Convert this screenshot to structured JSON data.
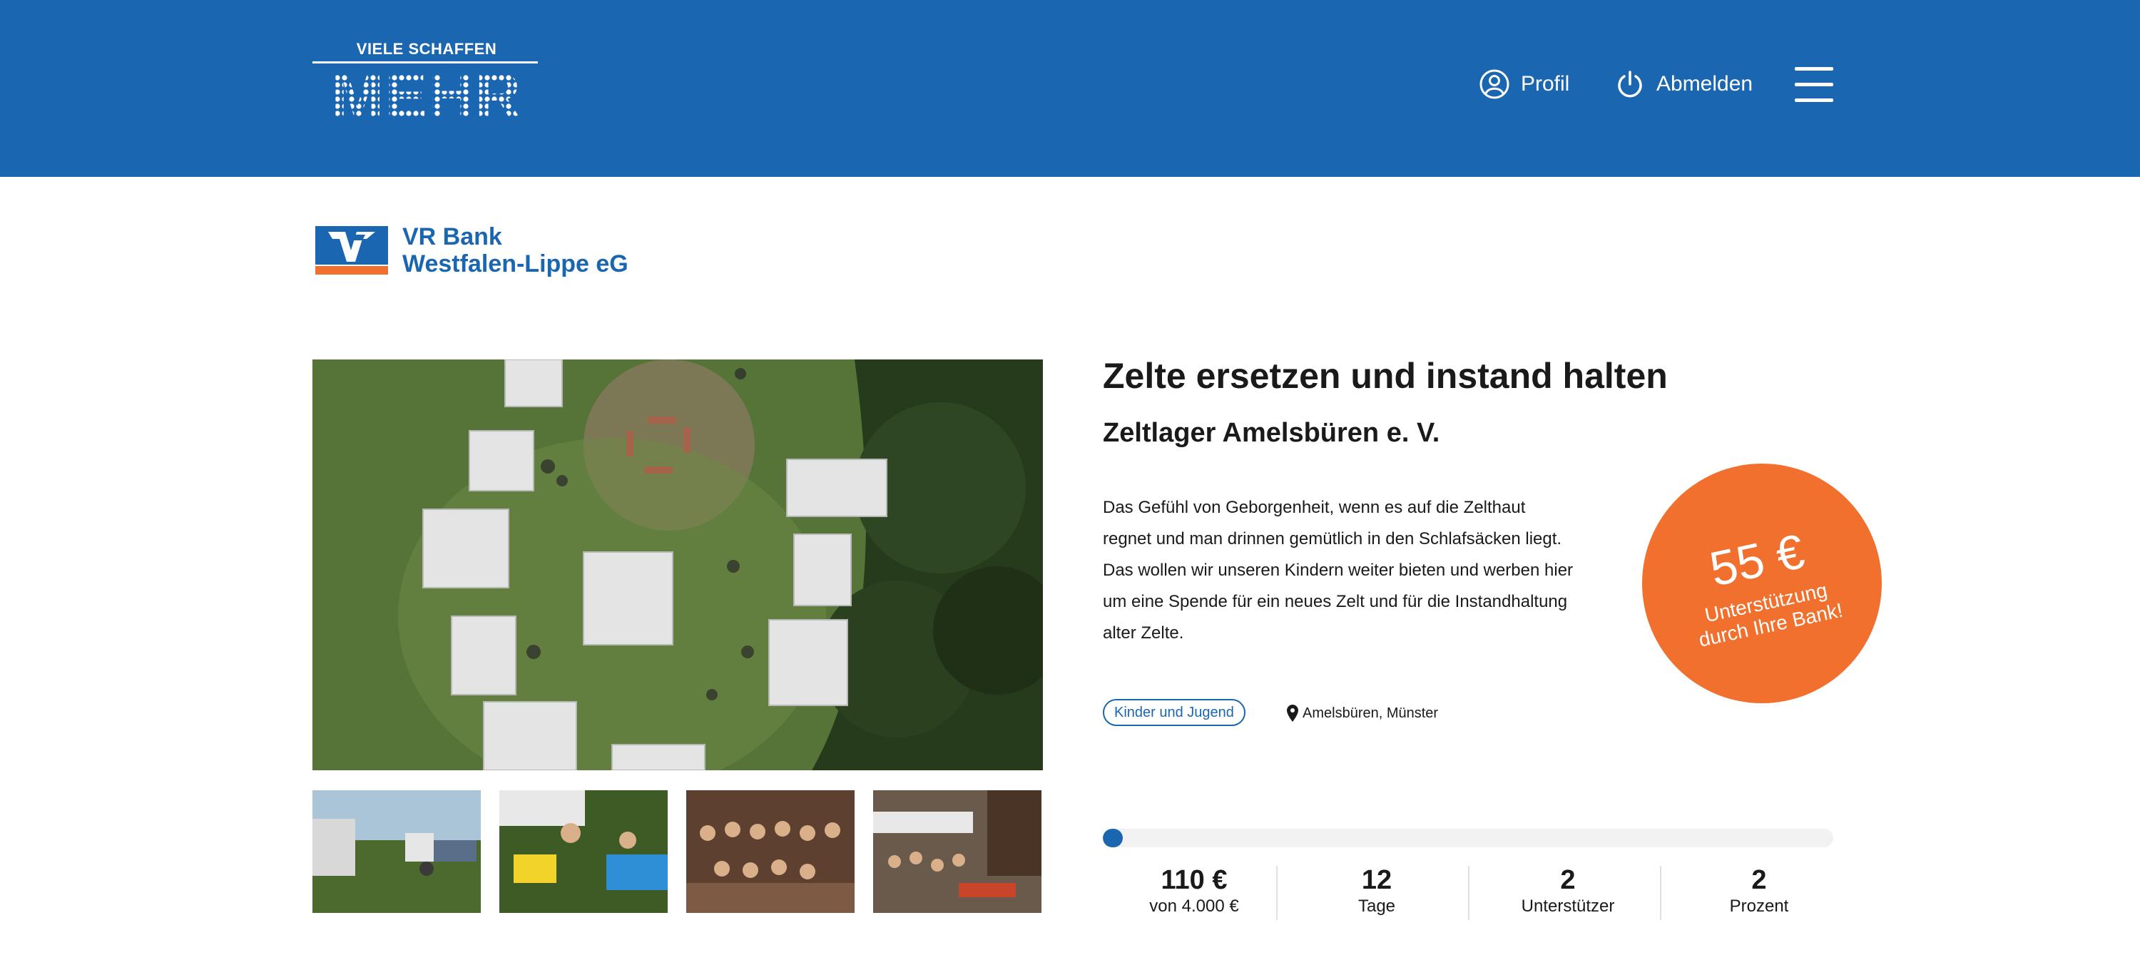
{
  "header": {
    "logo_top": "VIELE SCHAFFEN",
    "logo_main": "MEHR",
    "profile_label": "Profil",
    "logout_label": "Abmelden",
    "bg_color": "#1b66b1"
  },
  "bank": {
    "name_line1": "VR Bank",
    "name_line2": "Westfalen-Lippe eG"
  },
  "project": {
    "title": "Zelte ersetzen und instand halten",
    "organization": "Zeltlager Amelsbüren e. V.",
    "description": "Das Gefühl von Geborgenheit, wenn es auf die Zelthaut regnet und man drinnen gemütlich in den Schlafsäcken liegt. Das wollen wir unseren Kindern weiter bieten und werben hier um eine Spende für ein neues Zelt und für die Instandhaltung alter Zelte.",
    "category": "Kinder und Jugend",
    "location": "Amelsbüren, Münster"
  },
  "bubble": {
    "amount": "55 €",
    "line1": "Unterstützung",
    "line2": "durch Ihre Bank!",
    "color": "#f2702d"
  },
  "progress": {
    "fraction": 0.0275
  },
  "stats": {
    "raised_value": "110 €",
    "raised_label": "von 4.000 €",
    "days_value": "12",
    "days_label": "Tage",
    "supporters_value": "2",
    "supporters_label": "Unterstützer",
    "percent_value": "2",
    "percent_label": "Prozent"
  }
}
